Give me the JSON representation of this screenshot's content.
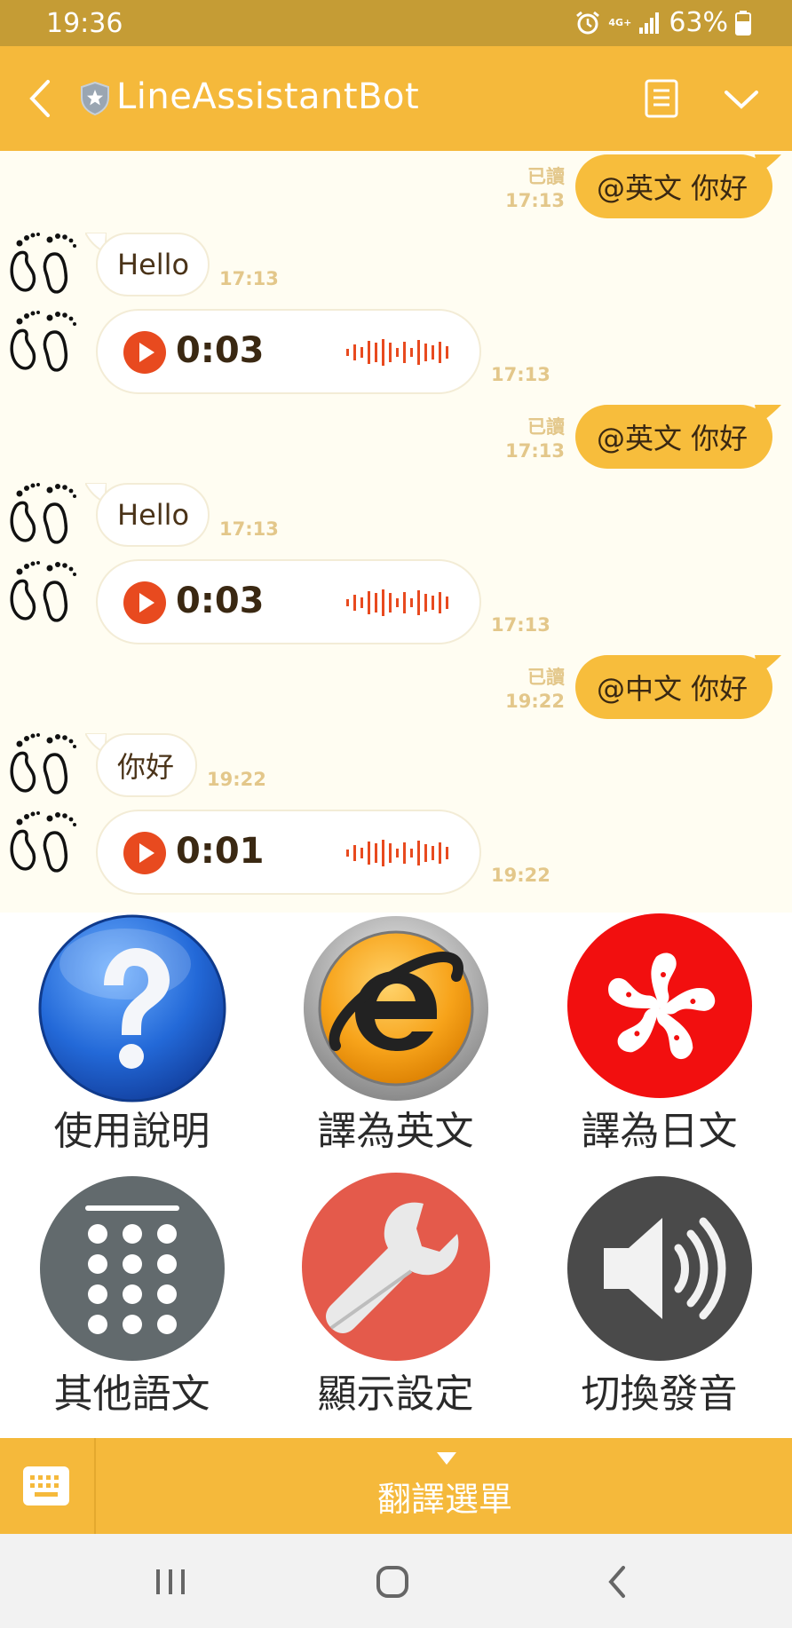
{
  "status": {
    "time": "19:36",
    "network": "4G+",
    "battery": "63%"
  },
  "header": {
    "title": "LineAssistantBot"
  },
  "chat": {
    "out1": {
      "text": "@英文 你好",
      "read": "已讀",
      "time": "17:13"
    },
    "in1": {
      "text": "Hello",
      "time": "17:13"
    },
    "voice1": {
      "duration": "0:03",
      "time": "17:13"
    },
    "out2": {
      "text": "@英文 你好",
      "read": "已讀",
      "time": "17:13"
    },
    "in2": {
      "text": "Hello",
      "time": "17:13"
    },
    "voice2": {
      "duration": "0:03",
      "time": "17:13"
    },
    "out3": {
      "text": "@中文 你好",
      "read": "已讀",
      "time": "19:22"
    },
    "in3": {
      "text": "你好",
      "time": "19:22"
    },
    "voice3": {
      "duration": "0:01",
      "time": "19:22"
    }
  },
  "menu": {
    "items": [
      {
        "label": "使用說明",
        "icon": "question-icon"
      },
      {
        "label": "譯為英文",
        "icon": "browser-e-icon"
      },
      {
        "label": "譯為日文",
        "icon": "bauhinia-flower-icon"
      },
      {
        "label": "其他語文",
        "icon": "keypad-icon"
      },
      {
        "label": "顯示設定",
        "icon": "wrench-icon"
      },
      {
        "label": "切換發音",
        "icon": "speaker-icon"
      }
    ]
  },
  "bottom": {
    "menu_label": "翻譯選單"
  },
  "colors": {
    "header": "#f5b93b",
    "statusbar": "#c59c35",
    "bubble_out": "#f7bd3c",
    "accent_red": "#e84a1f"
  }
}
